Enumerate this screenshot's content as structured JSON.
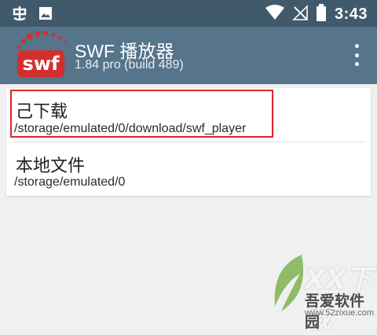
{
  "status_bar": {
    "time": "3:43",
    "left_icons": [
      "notification-app-icon",
      "image-icon"
    ],
    "right_icons": [
      "wifi-icon",
      "no-signal-icon",
      "battery-icon"
    ]
  },
  "app_bar": {
    "logo_text": "swf",
    "title": "SWF 播放器",
    "subtitle": "1.84 pro (build 489)",
    "menu_icon": "more-vert-icon"
  },
  "folders": [
    {
      "title": "己下载",
      "path": "/storage/emulated/0/download/swf_player",
      "highlighted": true
    },
    {
      "title": "本地文件",
      "path": "/storage/emulated/0",
      "highlighted": false
    }
  ],
  "colors": {
    "status_bar": "#415a6b",
    "app_bar": "#56748a",
    "highlight_border": "#e0242c",
    "logo_red": "#d32f2f"
  },
  "watermark": {
    "logo_text": "XX下载",
    "site_name": "吾爱软件园",
    "url": "www.52zixue.com"
  }
}
